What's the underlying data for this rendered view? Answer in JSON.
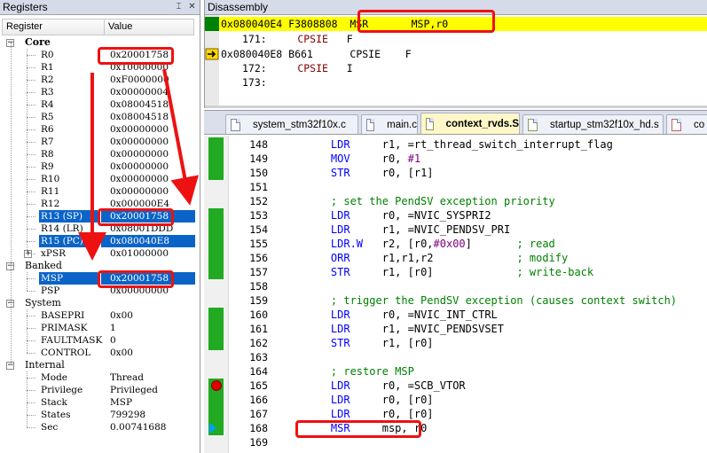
{
  "registers": {
    "title": "Registers",
    "col_register": "Register",
    "col_value": "Value",
    "groups": {
      "core": "Core",
      "banked": "Banked",
      "system": "System",
      "internal": "Internal"
    },
    "core": [
      {
        "name": "R0",
        "value": "0x20001758"
      },
      {
        "name": "R1",
        "value": "0x10000000"
      },
      {
        "name": "R2",
        "value": "0xF0000000"
      },
      {
        "name": "R3",
        "value": "0x00000004"
      },
      {
        "name": "R4",
        "value": "0x08004518"
      },
      {
        "name": "R5",
        "value": "0x08004518"
      },
      {
        "name": "R6",
        "value": "0x00000000"
      },
      {
        "name": "R7",
        "value": "0x00000000"
      },
      {
        "name": "R8",
        "value": "0x00000000"
      },
      {
        "name": "R9",
        "value": "0x00000000"
      },
      {
        "name": "R10",
        "value": "0x00000000"
      },
      {
        "name": "R11",
        "value": "0x00000000"
      },
      {
        "name": "R12",
        "value": "0x000000E4"
      },
      {
        "name": "R13 (SP)",
        "value": "0x20001758"
      },
      {
        "name": "R14 (LR)",
        "value": "0x08001DDD"
      },
      {
        "name": "R15 (PC)",
        "value": "0x080040E8"
      },
      {
        "name": "xPSR",
        "value": "0x01000000"
      }
    ],
    "banked": [
      {
        "name": "MSP",
        "value": "0x20001758"
      },
      {
        "name": "PSP",
        "value": "0x00000000"
      }
    ],
    "system": [
      {
        "name": "BASEPRI",
        "value": "0x00"
      },
      {
        "name": "PRIMASK",
        "value": "1"
      },
      {
        "name": "FAULTMASK",
        "value": "0"
      },
      {
        "name": "CONTROL",
        "value": "0x00"
      }
    ],
    "internal": [
      {
        "name": "Mode",
        "value": "Thread"
      },
      {
        "name": "Privilege",
        "value": "Privileged"
      },
      {
        "name": "Stack",
        "value": "MSP"
      },
      {
        "name": "States",
        "value": "799298"
      },
      {
        "name": "Sec",
        "value": "0.00741688"
      }
    ]
  },
  "disassembly": {
    "title": "Disassembly",
    "lines": [
      {
        "text": "0x080040E4 F3808808  MSR       MSP,r0",
        "current": true
      },
      {
        "text": "171:     CPSIE   F",
        "current": false,
        "source": true
      },
      {
        "text": "0x080040E8 B661      CPSIE    F",
        "current": false
      },
      {
        "text": "172:     CPSIE   I",
        "current": false,
        "source": true
      },
      {
        "text": "173:",
        "current": false,
        "source": true
      }
    ]
  },
  "tabs": [
    {
      "label": "system_stm32f10x.c",
      "type": "c"
    },
    {
      "label": "main.c",
      "type": "c"
    },
    {
      "label": "context_rvds.S",
      "type": "s",
      "active": true
    },
    {
      "label": "startup_stm32f10x_hd.s",
      "type": "s"
    },
    {
      "label": "co",
      "type": "h"
    }
  ],
  "editor": {
    "lines": [
      {
        "ln": "148",
        "code": "    LDR     r1, =rt_thread_switch_interrupt_flag",
        "exec": true
      },
      {
        "ln": "149",
        "code": "    MOV     r0, #1",
        "exec": true
      },
      {
        "ln": "150",
        "code": "    STR     r0, [r1]",
        "exec": true
      },
      {
        "ln": "151",
        "code": "",
        "exec": false
      },
      {
        "ln": "152",
        "code": "    ; set the PendSV exception priority",
        "exec": false
      },
      {
        "ln": "153",
        "code": "    LDR     r0, =NVIC_SYSPRI2",
        "exec": true
      },
      {
        "ln": "154",
        "code": "    LDR     r1, =NVIC_PENDSV_PRI",
        "exec": true
      },
      {
        "ln": "155",
        "code": "    LDR.W   r2, [r0,#0x00]       ; read",
        "exec": true
      },
      {
        "ln": "156",
        "code": "    ORR     r1,r1,r2             ; modify",
        "exec": true
      },
      {
        "ln": "157",
        "code": "    STR     r1, [r0]             ; write-back",
        "exec": true
      },
      {
        "ln": "158",
        "code": "",
        "exec": false
      },
      {
        "ln": "159",
        "code": "    ; trigger the PendSV exception (causes context switch)",
        "exec": false
      },
      {
        "ln": "160",
        "code": "    LDR     r0, =NVIC_INT_CTRL",
        "exec": true
      },
      {
        "ln": "161",
        "code": "    LDR     r1, =NVIC_PENDSVSET",
        "exec": true
      },
      {
        "ln": "162",
        "code": "    STR     r1, [r0]",
        "exec": true
      },
      {
        "ln": "163",
        "code": "",
        "exec": false
      },
      {
        "ln": "164",
        "code": "    ; restore MSP",
        "exec": false
      },
      {
        "ln": "165",
        "code": "    LDR     r0, =SCB_VTOR",
        "exec": true,
        "breakpoint": true
      },
      {
        "ln": "166",
        "code": "    LDR     r0, [r0]",
        "exec": true
      },
      {
        "ln": "167",
        "code": "    LDR     r0, [r0]",
        "exec": true
      },
      {
        "ln": "168",
        "code": "    MSR     msp, r0",
        "exec": false,
        "pc": true
      },
      {
        "ln": "169",
        "code": "",
        "exec": false
      }
    ]
  },
  "colors": {
    "selection": "#0a64c8",
    "annotation": "#ee1111",
    "current_line": "#ffff00",
    "exec_mark": "#22aa22",
    "keyword": "#0000ff",
    "comment": "#008000"
  }
}
